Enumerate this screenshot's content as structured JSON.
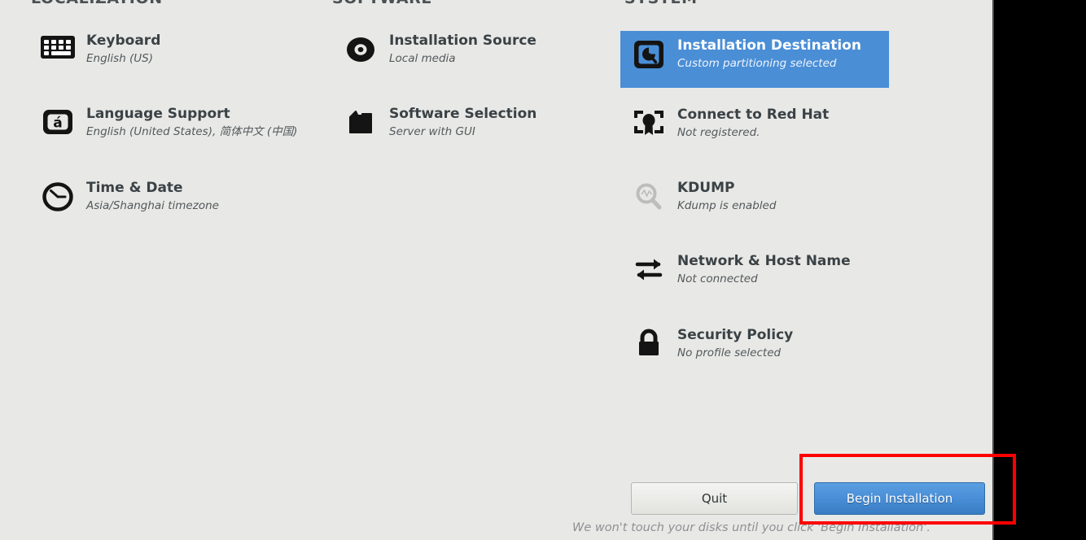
{
  "window": {
    "background_color": "#e8e8e6",
    "outside_color": "#000000",
    "highlight_color": "#4a8ed6",
    "annotation_color": "#fe0000"
  },
  "columns": [
    {
      "id": "localization",
      "header": "LOCALIZATION",
      "items": [
        {
          "icon": "keyboard-icon",
          "title": "Keyboard",
          "subtitle": "English (US)",
          "state": "normal"
        },
        {
          "icon": "language-support-icon",
          "title": "Language Support",
          "subtitle": "English (United States), 简体中文 (中国)",
          "state": "normal"
        },
        {
          "icon": "clock-icon",
          "title": "Time & Date",
          "subtitle": "Asia/Shanghai timezone",
          "state": "normal"
        }
      ]
    },
    {
      "id": "software",
      "header": "SOFTWARE",
      "items": [
        {
          "icon": "optical-disc-icon",
          "title": "Installation Source",
          "subtitle": "Local media",
          "state": "normal"
        },
        {
          "icon": "package-folder-icon",
          "title": "Software Selection",
          "subtitle": "Server with GUI",
          "state": "normal"
        }
      ]
    },
    {
      "id": "system",
      "header": "SYSTEM",
      "items": [
        {
          "icon": "hard-disk-icon",
          "title": "Installation Destination",
          "subtitle": "Custom partitioning selected",
          "state": "selected"
        },
        {
          "icon": "certificate-icon",
          "title": "Connect to Red Hat",
          "subtitle": "Not registered.",
          "state": "normal"
        },
        {
          "icon": "magnifier-icon",
          "title": "KDUMP",
          "subtitle": "Kdump is enabled",
          "state": "disabled"
        },
        {
          "icon": "network-arrows-icon",
          "title": "Network & Host Name",
          "subtitle": "Not connected",
          "state": "normal"
        },
        {
          "icon": "lock-icon",
          "title": "Security Policy",
          "subtitle": "No profile selected",
          "state": "normal"
        }
      ]
    }
  ],
  "footer": {
    "quit_label": "Quit",
    "begin_label": "Begin Installation",
    "note": "We won't touch your disks until you click 'Begin Installation'."
  }
}
